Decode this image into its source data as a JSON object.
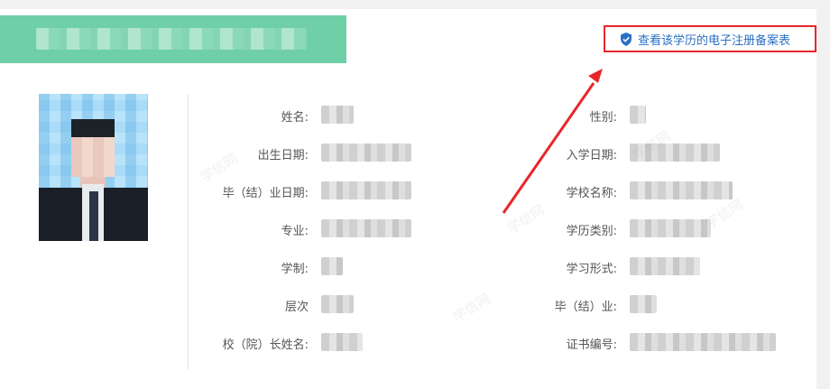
{
  "header": {
    "institution_name_redacted": true,
    "record_link_label": "查看该学历的电子注册备案表",
    "record_link_icon": "shield-check-icon",
    "accent_color": "#2a6fc4",
    "highlight_color": "#e8262b",
    "banner_color": "#6fcfa6"
  },
  "photo": {
    "redacted": true
  },
  "fields_left": [
    {
      "label": "姓名:"
    },
    {
      "label": "出生日期:"
    },
    {
      "label": "毕（结）业日期:"
    },
    {
      "label": "专业:"
    },
    {
      "label": "学制:"
    },
    {
      "label": "层次"
    },
    {
      "label": "校（院）长姓名:"
    }
  ],
  "fields_right": [
    {
      "label": "性别:"
    },
    {
      "label": "入学日期:"
    },
    {
      "label": "学校名称:"
    },
    {
      "label": "学历类别:"
    },
    {
      "label": "学习形式:"
    },
    {
      "label": "毕（结）业:"
    },
    {
      "label": "证书编号:"
    }
  ],
  "watermark_text": "学信网"
}
